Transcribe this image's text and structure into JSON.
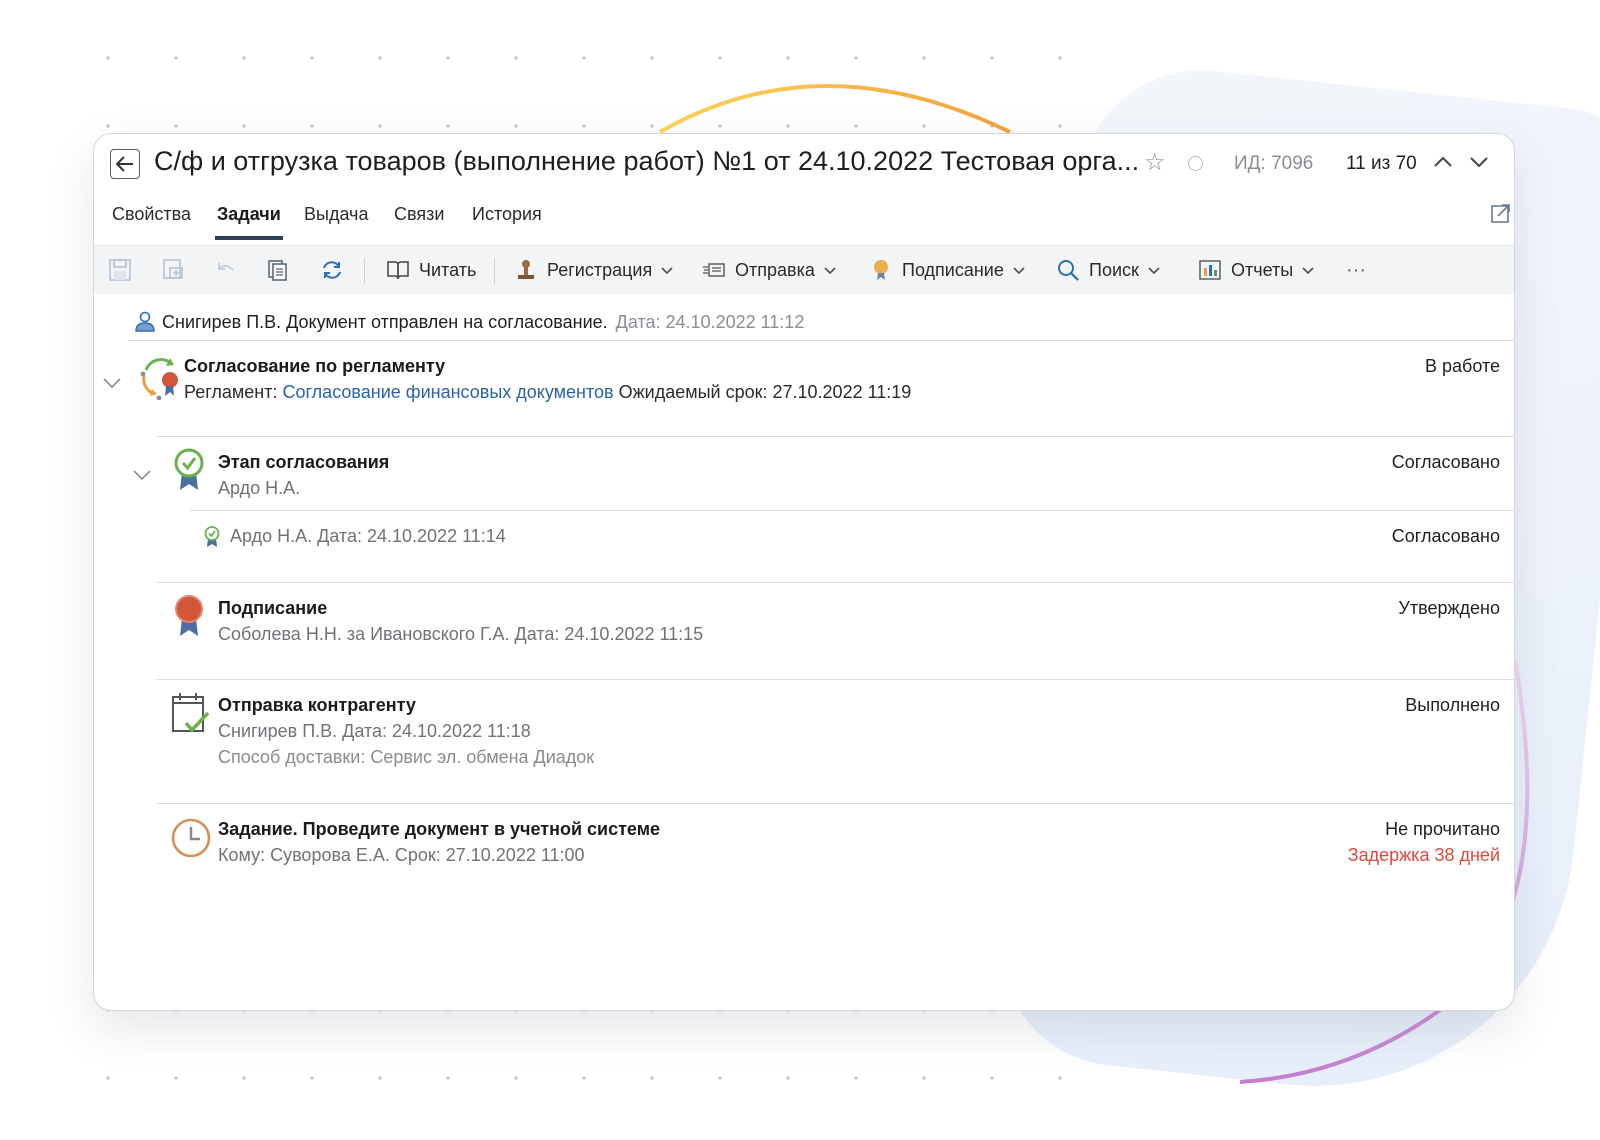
{
  "window": {
    "back_icon": "arrow-left-icon",
    "title": "С/ф и отгрузка товаров (выполнение работ) №1 от 24.10.2022 Тестовая орга...",
    "id_label": "ИД: 7096",
    "counter": "11 из 70"
  },
  "tabs": [
    {
      "label": "Свойства",
      "active": false
    },
    {
      "label": "Задачи",
      "active": true
    },
    {
      "label": "Выдача",
      "active": false
    },
    {
      "label": "Связи",
      "active": false
    },
    {
      "label": "История",
      "active": false
    }
  ],
  "toolbar": {
    "read_label": "Читать",
    "registration_label": "Регистрация",
    "send_label": "Отправка",
    "signing_label": "Подписание",
    "search_label": "Поиск",
    "reports_label": "Отчеты",
    "more_label": "···"
  },
  "sender": {
    "text": "Снигирев П.В. Документ отправлен на согласование.",
    "date": "Дата: 24.10.2022 11:12"
  },
  "tasks": {
    "reglament": {
      "title": "Согласование по регламенту",
      "reglament_label": "Регламент:",
      "reglament_link": "Согласование финансовых документов",
      "due": "Ожидаемый срок: 27.10.2022 11:19",
      "status": "В работе"
    },
    "stage": {
      "title": "Этап согласования",
      "person": "Ардо Н.А.",
      "status": "Согласовано"
    },
    "stage_sub": {
      "text": "Ардо Н.А.  Дата: 24.10.2022 11:14",
      "status": "Согласовано"
    },
    "signing": {
      "title": "Подписание",
      "sub": "Соболева Н.Н. за Ивановского Г.А. Дата: 24.10.2022 11:15",
      "status": "Утверждено"
    },
    "sending": {
      "title": "Отправка контрагенту",
      "sub": "Снигирев П.В. Дата: 24.10.2022 11:18",
      "delivery": "Способ доставки: Сервис эл. обмена Диадок",
      "status": "Выполнено"
    },
    "assignment": {
      "title": "Задание. Проведите документ в учетной системе",
      "sub": "Кому: Суворова Е.А. Срок: 27.10.2022 11:00",
      "status": "Не прочитано",
      "delay": "Задержка 38 дней"
    }
  },
  "colors": {
    "accent": "#2d3f5a",
    "link": "#2b62a6",
    "delay": "#e2473b",
    "approved_green": "#6ab04c",
    "seal_red": "#d2573a"
  }
}
